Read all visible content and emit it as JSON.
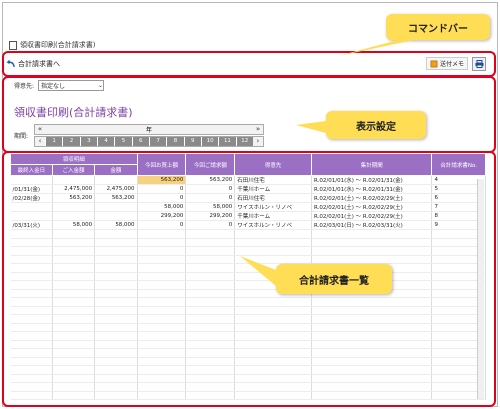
{
  "tab": {
    "label": "領収書印刷(合計請求書)"
  },
  "command_bar": {
    "back_label": "合計請求書へ",
    "memo_label": "送付メモ",
    "print_icon": "printer-icon"
  },
  "settings": {
    "store_label": "得意先:",
    "store_value": "指定なし",
    "title": "領収書印刷(合計請求書)",
    "period_label": "期間:",
    "year_text": "年",
    "months": [
      "1",
      "2",
      "3",
      "4",
      "5",
      "6",
      "7",
      "8",
      "9",
      "10",
      "11",
      "12"
    ]
  },
  "table": {
    "group_header": "領収明細",
    "headers": [
      "最終入金日",
      "ご入金額",
      "金額",
      "今回お買上額",
      "今回ご請求額",
      "得意先",
      "集計期間",
      "合計請求書No."
    ],
    "rows": [
      [
        "",
        "",
        "",
        "563,200",
        "563,200",
        "石田川住宅",
        "R.02/01/01(水) ～ R.02/01/31(金)",
        "4"
      ],
      [
        "/01/31(金)",
        "2,475,000",
        "2,475,000",
        "0",
        "0",
        "千葉川ホーム",
        "R.02/01/01(水) ～ R.02/01/31(金)",
        "5"
      ],
      [
        "/02/28(金)",
        "563,200",
        "563,200",
        "0",
        "0",
        "石田川住宅",
        "R.02/02/01(土) ～ R.02/02/29(土)",
        "6"
      ],
      [
        "",
        "",
        "",
        "58,000",
        "58,000",
        "ワイスホルン・リノベ",
        "R.02/02/01(土) ～ R.02/02/29(土)",
        "7"
      ],
      [
        "",
        "",
        "",
        "299,200",
        "299,200",
        "千葉川ホーム",
        "R.02/02/01(土) ～ R.02/02/29(土)",
        "8"
      ],
      [
        "/03/31(火)",
        "58,000",
        "58,000",
        "0",
        "0",
        "ワイスホルン・リノベ",
        "R.02/03/01(日) ～ R.02/03/31(火)",
        "9"
      ]
    ]
  },
  "callouts": {
    "command_bar": "コマンドバー",
    "display": "表示設定",
    "list": "合計請求書一覧"
  }
}
